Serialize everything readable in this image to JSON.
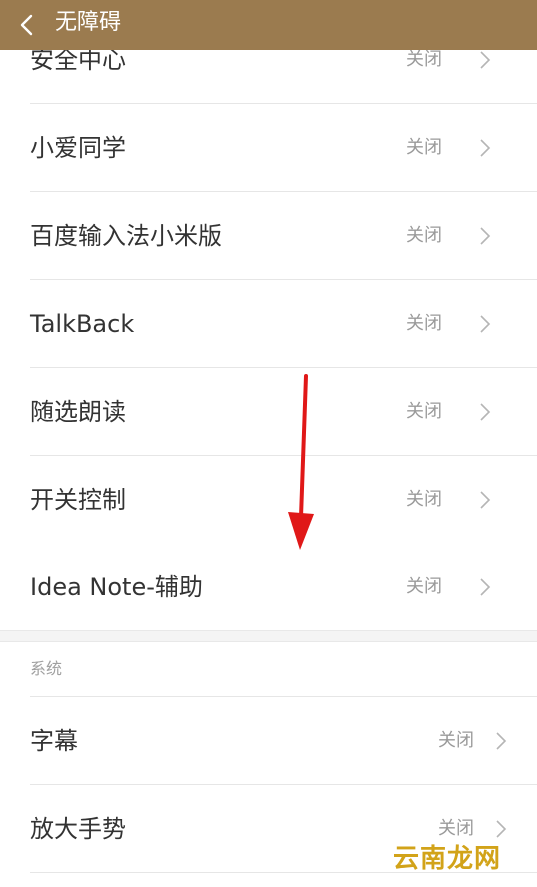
{
  "header": {
    "title": "无障碍"
  },
  "items": [
    {
      "label": "安全中心",
      "value": "关闭"
    },
    {
      "label": "小爱同学",
      "value": "关闭"
    },
    {
      "label": "百度输入法小米版",
      "value": "关闭"
    },
    {
      "label": "TalkBack",
      "value": "关闭"
    },
    {
      "label": "随选朗读",
      "value": "关闭"
    },
    {
      "label": "开关控制",
      "value": "关闭"
    },
    {
      "label": "Idea Note-辅助",
      "value": "关闭"
    }
  ],
  "system_section": {
    "title": "系统",
    "items": [
      {
        "label": "字幕",
        "value": "关闭"
      },
      {
        "label": "放大手势",
        "value": "关闭"
      }
    ]
  },
  "watermark": {
    "text": "云南龙网"
  },
  "colors": {
    "header_bg": "#9b7b4f",
    "annotation_arrow": "#e01818"
  },
  "icons": {
    "back": "chevron-left-icon",
    "row_arrow": "chevron-right-icon"
  }
}
